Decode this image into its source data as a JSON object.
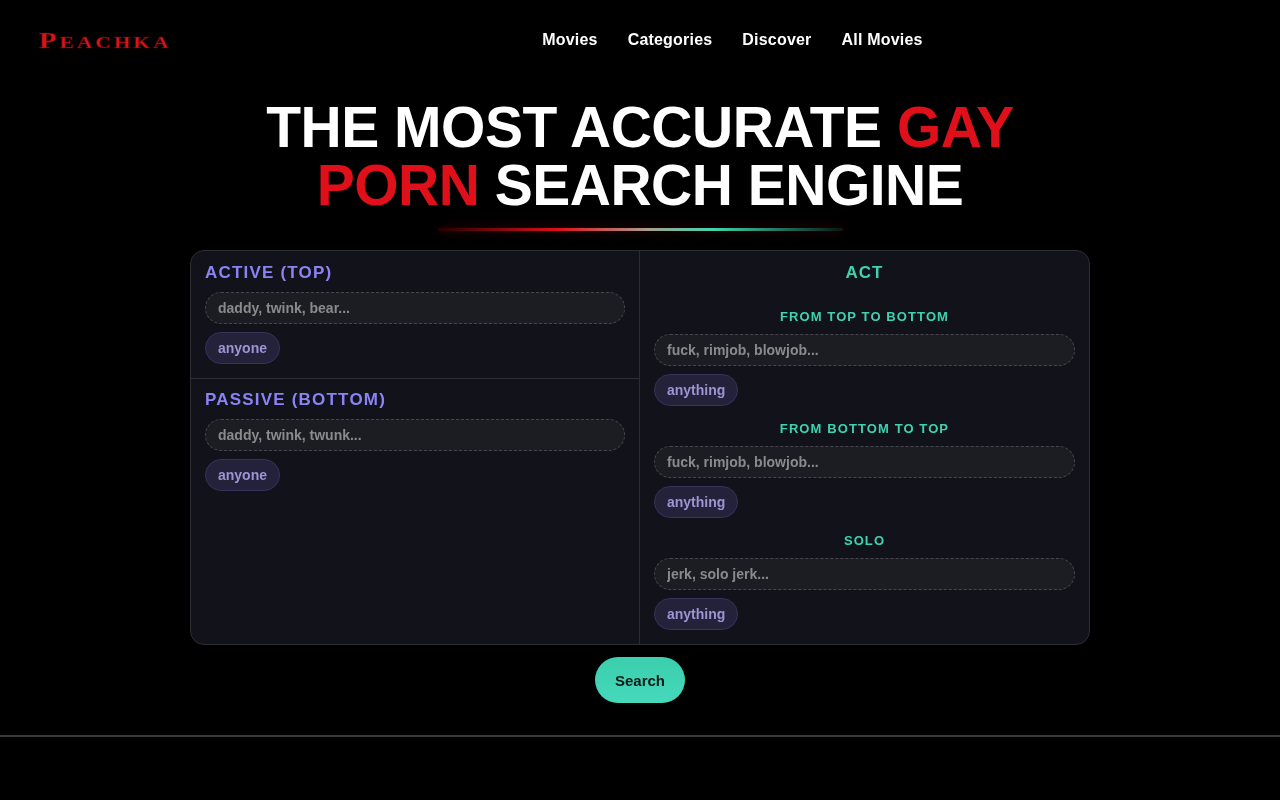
{
  "header": {
    "logo": "PEACHKA",
    "nav": [
      "Movies",
      "Categories",
      "Discover",
      "All Movies"
    ]
  },
  "hero": {
    "headline": [
      {
        "text": "THE MOST ACCURATE ",
        "highlight": false
      },
      {
        "text": "GAY PORN",
        "highlight": true
      },
      {
        "text": " SEARCH ENGINE",
        "highlight": false
      }
    ]
  },
  "filters": {
    "roles": [
      {
        "title": "ACTIVE (TOP)",
        "field": {
          "placeholder": "daddy, twink, bear..."
        },
        "chip": "anyone"
      },
      {
        "title": "PASSIVE (BOTTOM)",
        "field": {
          "placeholder": "daddy, twink, twunk..."
        },
        "chip": "anyone"
      }
    ],
    "act": {
      "title": "ACT",
      "groups": [
        {
          "title": "FROM TOP TO BOTTOM",
          "field": {
            "placeholder": "fuck, rimjob, blowjob..."
          },
          "chip": "anything"
        },
        {
          "title": "FROM BOTTOM TO TOP",
          "field": {
            "placeholder": "fuck, rimjob, blowjob..."
          },
          "chip": "anything"
        },
        {
          "title": "SOLO",
          "field": {
            "placeholder": "jerk, solo jerk..."
          },
          "chip": "anything"
        }
      ]
    }
  },
  "search_button": "Search"
}
